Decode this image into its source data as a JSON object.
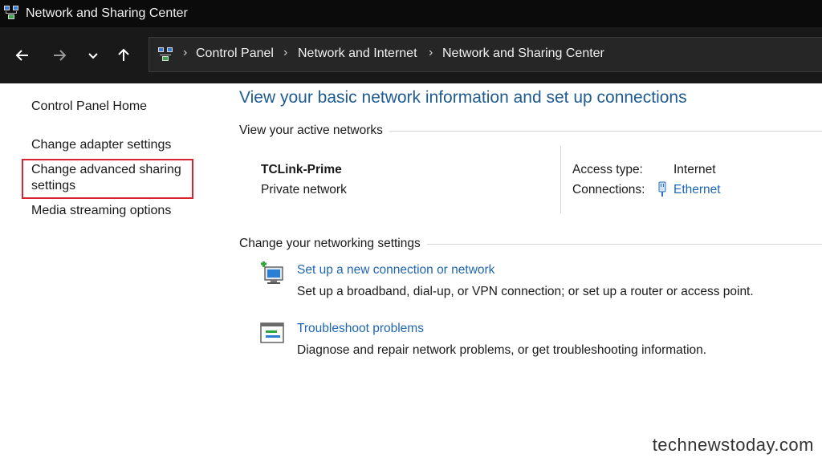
{
  "window": {
    "title": "Network and Sharing Center",
    "icon": "network-center-icon"
  },
  "nav": {
    "back_icon": "back-arrow-icon",
    "forward_icon": "forward-arrow-icon",
    "recent_icon": "chevron-down-icon",
    "up_icon": "up-arrow-icon",
    "breadcrumb": [
      "Control Panel",
      "Network and Internet",
      "Network and Sharing Center"
    ]
  },
  "sidebar": {
    "items": [
      "Control Panel Home",
      "Change adapter settings",
      "Change advanced sharing",
      "settings",
      "Media streaming options"
    ],
    "highlight_color": "#d9232e"
  },
  "main": {
    "heading": "View your basic network information and set up connections",
    "active_networks_label": "View your active networks",
    "network": {
      "name": "TCLink-Prime",
      "type": "Private network",
      "access_type_label": "Access type:",
      "access_type_value": "Internet",
      "connections_label": "Connections:",
      "connections_value": "Ethernet"
    },
    "change_settings_label": "Change your networking settings",
    "tasks": [
      {
        "icon": "new-connection-icon",
        "title": "Set up a new connection or network",
        "description": "Set up a broadband, dial-up, or VPN connection; or set up a router or access point."
      },
      {
        "icon": "troubleshoot-icon",
        "title": "Troubleshoot problems",
        "description": "Diagnose and repair network problems, or get troubleshooting information."
      }
    ]
  },
  "watermark": "technewstoday.com",
  "colors": {
    "link": "#1e66b3",
    "heading": "#1f5b91",
    "titlebar": "#0b0b0b",
    "navbar": "#191919"
  }
}
